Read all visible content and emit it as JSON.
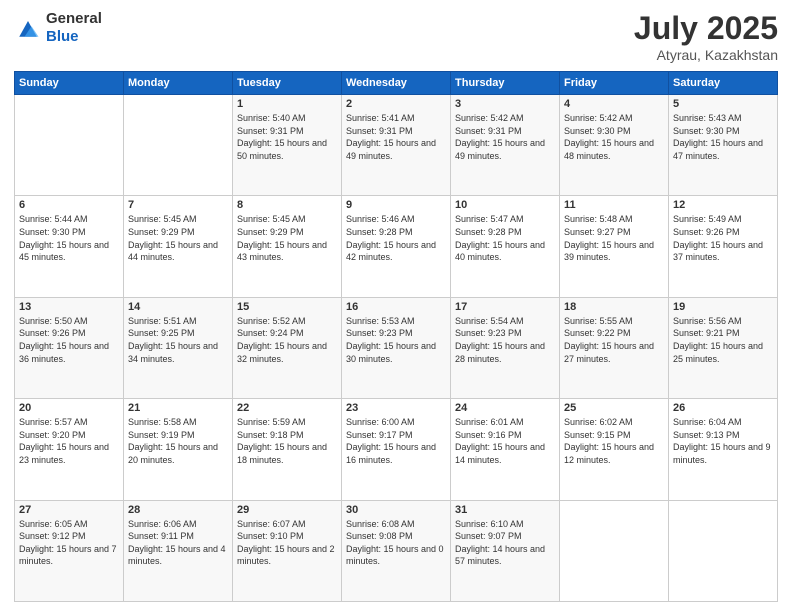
{
  "logo": {
    "general": "General",
    "blue": "Blue"
  },
  "title": {
    "month_year": "July 2025",
    "location": "Atyrau, Kazakhstan"
  },
  "weekdays": [
    "Sunday",
    "Monday",
    "Tuesday",
    "Wednesday",
    "Thursday",
    "Friday",
    "Saturday"
  ],
  "weeks": [
    [
      {
        "day": "",
        "sunrise": "",
        "sunset": "",
        "daylight": ""
      },
      {
        "day": "",
        "sunrise": "",
        "sunset": "",
        "daylight": ""
      },
      {
        "day": "1",
        "sunrise": "Sunrise: 5:40 AM",
        "sunset": "Sunset: 9:31 PM",
        "daylight": "Daylight: 15 hours and 50 minutes."
      },
      {
        "day": "2",
        "sunrise": "Sunrise: 5:41 AM",
        "sunset": "Sunset: 9:31 PM",
        "daylight": "Daylight: 15 hours and 49 minutes."
      },
      {
        "day": "3",
        "sunrise": "Sunrise: 5:42 AM",
        "sunset": "Sunset: 9:31 PM",
        "daylight": "Daylight: 15 hours and 49 minutes."
      },
      {
        "day": "4",
        "sunrise": "Sunrise: 5:42 AM",
        "sunset": "Sunset: 9:30 PM",
        "daylight": "Daylight: 15 hours and 48 minutes."
      },
      {
        "day": "5",
        "sunrise": "Sunrise: 5:43 AM",
        "sunset": "Sunset: 9:30 PM",
        "daylight": "Daylight: 15 hours and 47 minutes."
      }
    ],
    [
      {
        "day": "6",
        "sunrise": "Sunrise: 5:44 AM",
        "sunset": "Sunset: 9:30 PM",
        "daylight": "Daylight: 15 hours and 45 minutes."
      },
      {
        "day": "7",
        "sunrise": "Sunrise: 5:45 AM",
        "sunset": "Sunset: 9:29 PM",
        "daylight": "Daylight: 15 hours and 44 minutes."
      },
      {
        "day": "8",
        "sunrise": "Sunrise: 5:45 AM",
        "sunset": "Sunset: 9:29 PM",
        "daylight": "Daylight: 15 hours and 43 minutes."
      },
      {
        "day": "9",
        "sunrise": "Sunrise: 5:46 AM",
        "sunset": "Sunset: 9:28 PM",
        "daylight": "Daylight: 15 hours and 42 minutes."
      },
      {
        "day": "10",
        "sunrise": "Sunrise: 5:47 AM",
        "sunset": "Sunset: 9:28 PM",
        "daylight": "Daylight: 15 hours and 40 minutes."
      },
      {
        "day": "11",
        "sunrise": "Sunrise: 5:48 AM",
        "sunset": "Sunset: 9:27 PM",
        "daylight": "Daylight: 15 hours and 39 minutes."
      },
      {
        "day": "12",
        "sunrise": "Sunrise: 5:49 AM",
        "sunset": "Sunset: 9:26 PM",
        "daylight": "Daylight: 15 hours and 37 minutes."
      }
    ],
    [
      {
        "day": "13",
        "sunrise": "Sunrise: 5:50 AM",
        "sunset": "Sunset: 9:26 PM",
        "daylight": "Daylight: 15 hours and 36 minutes."
      },
      {
        "day": "14",
        "sunrise": "Sunrise: 5:51 AM",
        "sunset": "Sunset: 9:25 PM",
        "daylight": "Daylight: 15 hours and 34 minutes."
      },
      {
        "day": "15",
        "sunrise": "Sunrise: 5:52 AM",
        "sunset": "Sunset: 9:24 PM",
        "daylight": "Daylight: 15 hours and 32 minutes."
      },
      {
        "day": "16",
        "sunrise": "Sunrise: 5:53 AM",
        "sunset": "Sunset: 9:23 PM",
        "daylight": "Daylight: 15 hours and 30 minutes."
      },
      {
        "day": "17",
        "sunrise": "Sunrise: 5:54 AM",
        "sunset": "Sunset: 9:23 PM",
        "daylight": "Daylight: 15 hours and 28 minutes."
      },
      {
        "day": "18",
        "sunrise": "Sunrise: 5:55 AM",
        "sunset": "Sunset: 9:22 PM",
        "daylight": "Daylight: 15 hours and 27 minutes."
      },
      {
        "day": "19",
        "sunrise": "Sunrise: 5:56 AM",
        "sunset": "Sunset: 9:21 PM",
        "daylight": "Daylight: 15 hours and 25 minutes."
      }
    ],
    [
      {
        "day": "20",
        "sunrise": "Sunrise: 5:57 AM",
        "sunset": "Sunset: 9:20 PM",
        "daylight": "Daylight: 15 hours and 23 minutes."
      },
      {
        "day": "21",
        "sunrise": "Sunrise: 5:58 AM",
        "sunset": "Sunset: 9:19 PM",
        "daylight": "Daylight: 15 hours and 20 minutes."
      },
      {
        "day": "22",
        "sunrise": "Sunrise: 5:59 AM",
        "sunset": "Sunset: 9:18 PM",
        "daylight": "Daylight: 15 hours and 18 minutes."
      },
      {
        "day": "23",
        "sunrise": "Sunrise: 6:00 AM",
        "sunset": "Sunset: 9:17 PM",
        "daylight": "Daylight: 15 hours and 16 minutes."
      },
      {
        "day": "24",
        "sunrise": "Sunrise: 6:01 AM",
        "sunset": "Sunset: 9:16 PM",
        "daylight": "Daylight: 15 hours and 14 minutes."
      },
      {
        "day": "25",
        "sunrise": "Sunrise: 6:02 AM",
        "sunset": "Sunset: 9:15 PM",
        "daylight": "Daylight: 15 hours and 12 minutes."
      },
      {
        "day": "26",
        "sunrise": "Sunrise: 6:04 AM",
        "sunset": "Sunset: 9:13 PM",
        "daylight": "Daylight: 15 hours and 9 minutes."
      }
    ],
    [
      {
        "day": "27",
        "sunrise": "Sunrise: 6:05 AM",
        "sunset": "Sunset: 9:12 PM",
        "daylight": "Daylight: 15 hours and 7 minutes."
      },
      {
        "day": "28",
        "sunrise": "Sunrise: 6:06 AM",
        "sunset": "Sunset: 9:11 PM",
        "daylight": "Daylight: 15 hours and 4 minutes."
      },
      {
        "day": "29",
        "sunrise": "Sunrise: 6:07 AM",
        "sunset": "Sunset: 9:10 PM",
        "daylight": "Daylight: 15 hours and 2 minutes."
      },
      {
        "day": "30",
        "sunrise": "Sunrise: 6:08 AM",
        "sunset": "Sunset: 9:08 PM",
        "daylight": "Daylight: 15 hours and 0 minutes."
      },
      {
        "day": "31",
        "sunrise": "Sunrise: 6:10 AM",
        "sunset": "Sunset: 9:07 PM",
        "daylight": "Daylight: 14 hours and 57 minutes."
      },
      {
        "day": "",
        "sunrise": "",
        "sunset": "",
        "daylight": ""
      },
      {
        "day": "",
        "sunrise": "",
        "sunset": "",
        "daylight": ""
      }
    ]
  ]
}
